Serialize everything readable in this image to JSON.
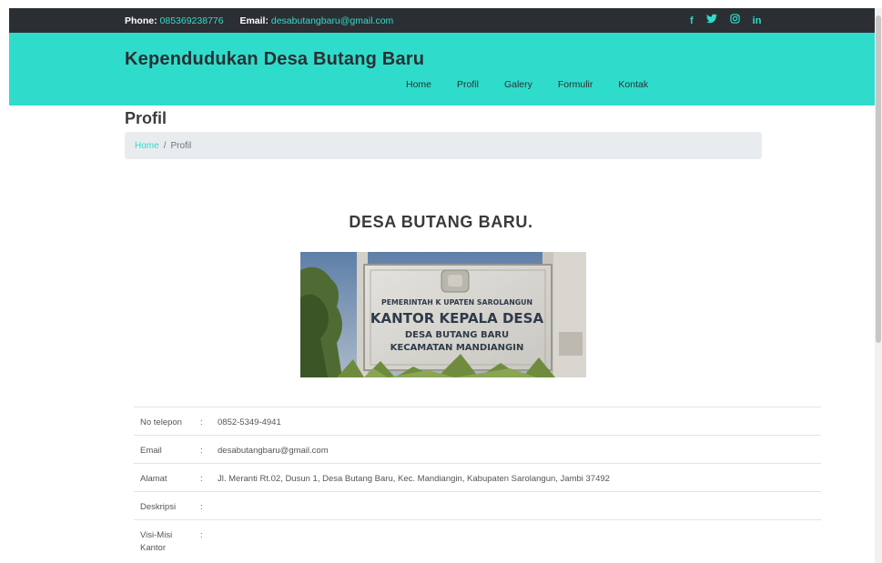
{
  "topbar": {
    "phone_label": "Phone:",
    "phone_value": "085369238776",
    "email_label": "Email:",
    "email_value": "desabutangbaru@gmail.com",
    "social": [
      {
        "icon": "facebook-icon",
        "glyph": "f"
      },
      {
        "icon": "twitter-icon",
        "glyph": "🐦"
      },
      {
        "icon": "instagram-icon",
        "glyph": "◎"
      },
      {
        "icon": "linkedin-icon",
        "glyph": "in"
      }
    ]
  },
  "header": {
    "brand": "Kependudukan Desa Butang Baru",
    "nav": [
      "Home",
      "Profil",
      "Galery",
      "Formulir",
      "Kontak"
    ]
  },
  "page": {
    "title": "Profil",
    "breadcrumb": {
      "home": "Home",
      "separator": "/",
      "current": "Profil"
    },
    "heading": "DESA BUTANG BARU."
  },
  "sign": {
    "line1": "PEMERINTAH K  UPATEN SAROLANGUN",
    "line2": "KANTOR KEPALA DESA",
    "line3": "DESA BUTANG BARU",
    "line4": "KECAMATAN MANDIANGIN"
  },
  "info": {
    "separator": ":",
    "rows": [
      {
        "key": "No telepon",
        "value": "0852-5349-4941"
      },
      {
        "key": "Email",
        "value": "desabutangbaru@gmail.com"
      },
      {
        "key": "Alamat",
        "value": "Jl. Meranti Rt.02, Dusun 1, Desa Butang Baru, Kec. Mandiangin, Kabupaten Sarolangun, Jambi 37492"
      },
      {
        "key": "Deskripsi",
        "value": ""
      },
      {
        "key": "Visi-Misi\nKantor",
        "value": ""
      }
    ]
  },
  "colors": {
    "accent": "#2fdccb",
    "topbar": "#2b2f33",
    "breadcrumb_bg": "#e9ecef"
  }
}
